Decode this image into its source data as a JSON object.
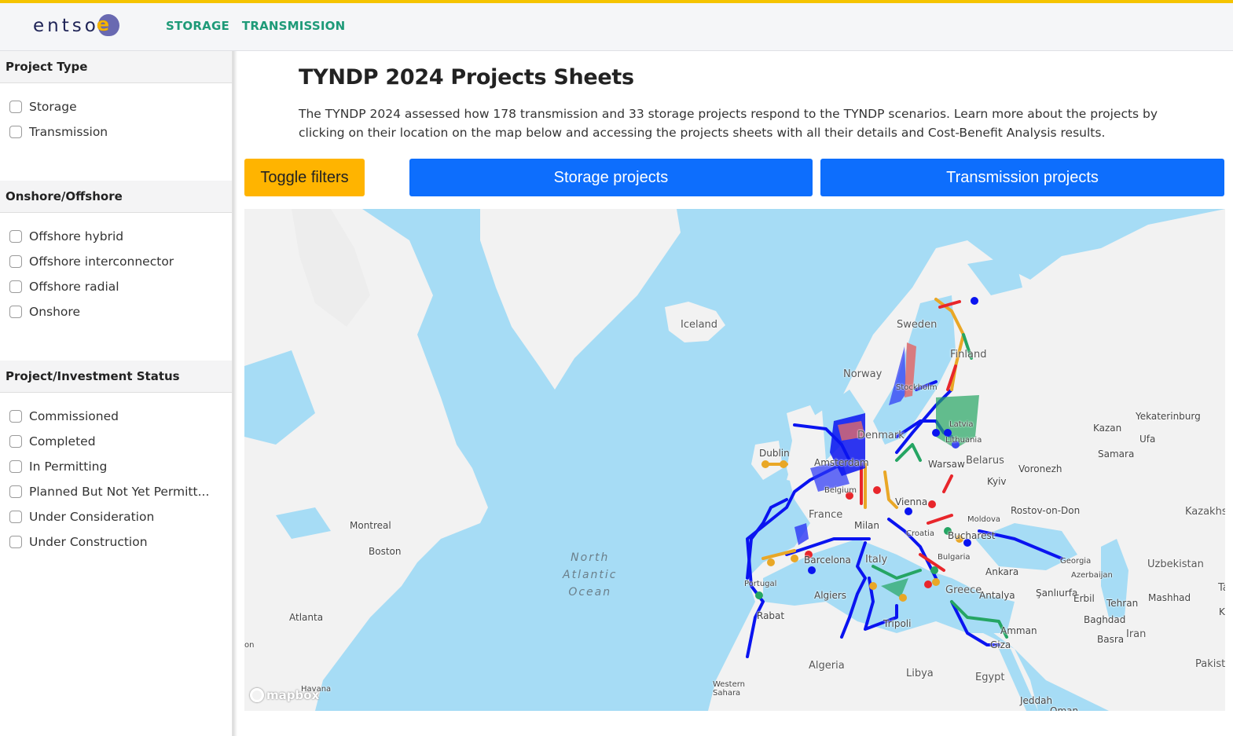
{
  "header": {
    "logo_text": "entso",
    "logo_e": "e",
    "nav": [
      "STORAGE",
      "TRANSMISSION"
    ]
  },
  "sidebar": {
    "sections": [
      {
        "title": "Project Type",
        "options": [
          "Storage",
          "Transmission"
        ]
      },
      {
        "title": "Onshore/Offshore",
        "options": [
          "Offshore hybrid",
          "Offshore interconnector",
          "Offshore radial",
          "Onshore"
        ]
      },
      {
        "title": "Project/Investment Status",
        "options": [
          "Commissioned",
          "Completed",
          "In Permitting",
          "Planned But Not Yet Permitt...",
          "Under Consideration",
          "Under Construction"
        ]
      }
    ]
  },
  "main": {
    "title": "TYNDP 2024 Projects Sheets",
    "description": "The TYNDP 2024 assessed how 178 transmission and 33 storage projects respond to the TYNDP scenarios. Learn more about the projects by clicking on their location on the map below and accessing the projects sheets with all their details and Cost-Benefit Analysis results.",
    "buttons": {
      "toggle_filters": "Toggle filters",
      "storage_projects": "Storage projects",
      "transmission_projects": "Transmission projects"
    }
  },
  "map": {
    "attribution": "mapbox",
    "ocean_label": [
      "North",
      "Atlantic",
      "Ocean"
    ],
    "colors": {
      "water": "#a6dcf5",
      "land": "#f2f2f2",
      "blue": "#0a14f0",
      "red": "#e8262b",
      "orange": "#e9a726",
      "green": "#25a563",
      "pink": "#e06a6a"
    },
    "labels": [
      {
        "text": "Iceland",
        "kind": "country"
      },
      {
        "text": "Sweden",
        "kind": "country"
      },
      {
        "text": "Finland",
        "kind": "country"
      },
      {
        "text": "Norway",
        "kind": "country"
      },
      {
        "text": "Stockholm",
        "kind": "city"
      },
      {
        "text": "Denmark",
        "kind": "country"
      },
      {
        "text": "Dublin",
        "kind": "city"
      },
      {
        "text": "Latvia",
        "kind": "country"
      },
      {
        "text": "Lithuania",
        "kind": "country"
      },
      {
        "text": "Belarus",
        "kind": "country"
      },
      {
        "text": "Warsaw",
        "kind": "city"
      },
      {
        "text": "Kyiv",
        "kind": "city"
      },
      {
        "text": "Amsterdam",
        "kind": "city"
      },
      {
        "text": "Belgium",
        "kind": "country"
      },
      {
        "text": "France",
        "kind": "country"
      },
      {
        "text": "Vienna",
        "kind": "city"
      },
      {
        "text": "Milan",
        "kind": "city"
      },
      {
        "text": "Croatia",
        "kind": "country"
      },
      {
        "text": "Moldova",
        "kind": "country"
      },
      {
        "text": "Bucharest",
        "kind": "city"
      },
      {
        "text": "Bulgaria",
        "kind": "country"
      },
      {
        "text": "Barcelona",
        "kind": "city"
      },
      {
        "text": "Italy",
        "kind": "country"
      },
      {
        "text": "Portugal",
        "kind": "country"
      },
      {
        "text": "Algiers",
        "kind": "city"
      },
      {
        "text": "Rabat",
        "kind": "city"
      },
      {
        "text": "Tripoli",
        "kind": "city"
      },
      {
        "text": "Greece",
        "kind": "country"
      },
      {
        "text": "Ankara",
        "kind": "city"
      },
      {
        "text": "Antalya",
        "kind": "city"
      },
      {
        "text": "Şanlıurfa",
        "kind": "city"
      },
      {
        "text": "Amman",
        "kind": "city"
      },
      {
        "text": "Giza",
        "kind": "city"
      },
      {
        "text": "Algeria",
        "kind": "country"
      },
      {
        "text": "Libya",
        "kind": "country"
      },
      {
        "text": "Egypt",
        "kind": "country"
      },
      {
        "text": "Western Sahara",
        "kind": "country"
      },
      {
        "text": "Jeddah",
        "kind": "city"
      },
      {
        "text": "Oman",
        "kind": "country"
      },
      {
        "text": "Yekaterinburg",
        "kind": "city"
      },
      {
        "text": "Kazan",
        "kind": "city"
      },
      {
        "text": "Ufa",
        "kind": "city"
      },
      {
        "text": "Samara",
        "kind": "city"
      },
      {
        "text": "Voronezh",
        "kind": "city"
      },
      {
        "text": "Rostov-on-Don",
        "kind": "city"
      },
      {
        "text": "Kazakhs",
        "kind": "country"
      },
      {
        "text": "Georgia",
        "kind": "country"
      },
      {
        "text": "Azerbaijan",
        "kind": "country"
      },
      {
        "text": "Uzbekistan",
        "kind": "country"
      },
      {
        "text": "Erbil",
        "kind": "city"
      },
      {
        "text": "Tehran",
        "kind": "city"
      },
      {
        "text": "Mashhad",
        "kind": "city"
      },
      {
        "text": "Baghdad",
        "kind": "city"
      },
      {
        "text": "Basra",
        "kind": "city"
      },
      {
        "text": "Iran",
        "kind": "country"
      },
      {
        "text": "Pakist",
        "kind": "country"
      },
      {
        "text": "Ta",
        "kind": "country"
      },
      {
        "text": "Kal",
        "kind": "city"
      },
      {
        "text": "Montreal",
        "kind": "city"
      },
      {
        "text": "Boston",
        "kind": "city"
      },
      {
        "text": "Atlanta",
        "kind": "city"
      },
      {
        "text": "Havana",
        "kind": "city"
      },
      {
        "text": "on",
        "kind": "city"
      }
    ]
  }
}
